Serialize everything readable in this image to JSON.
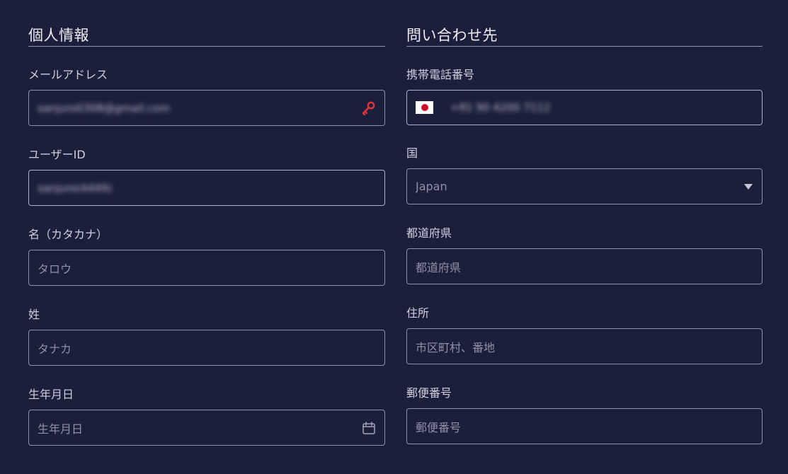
{
  "personal": {
    "title": "個人情報",
    "email": {
      "label": "メールアドレス",
      "value": "sanjuro0308@gmail.com",
      "icon": "key-icon"
    },
    "user_id": {
      "label": "ユーザーID",
      "value": "sanjuro(4449)"
    },
    "first_name_kana": {
      "label": "名（カタカナ）",
      "placeholder": "タロウ"
    },
    "last_name_kana": {
      "label": "姓",
      "placeholder": "タナカ"
    },
    "birthdate": {
      "label": "生年月日",
      "placeholder": "生年月日",
      "icon": "calendar-icon"
    }
  },
  "contact": {
    "title": "問い合わせ先",
    "mobile": {
      "label": "携帯電話番号",
      "value": "+81 90 4200 7112",
      "flag": "japan-flag-icon"
    },
    "country": {
      "label": "国",
      "value": "Japan",
      "icon": "caret-down-icon"
    },
    "prefecture": {
      "label": "都道府県",
      "placeholder": "都道府県"
    },
    "address": {
      "label": "住所",
      "placeholder": "市区町村、番地"
    },
    "postal_code": {
      "label": "郵便番号",
      "placeholder": "郵便番号"
    }
  },
  "colors": {
    "background": "#1c1f3b",
    "border": "#8e92a9",
    "key_icon": "#e0353d",
    "flag_red": "#c8102e"
  }
}
